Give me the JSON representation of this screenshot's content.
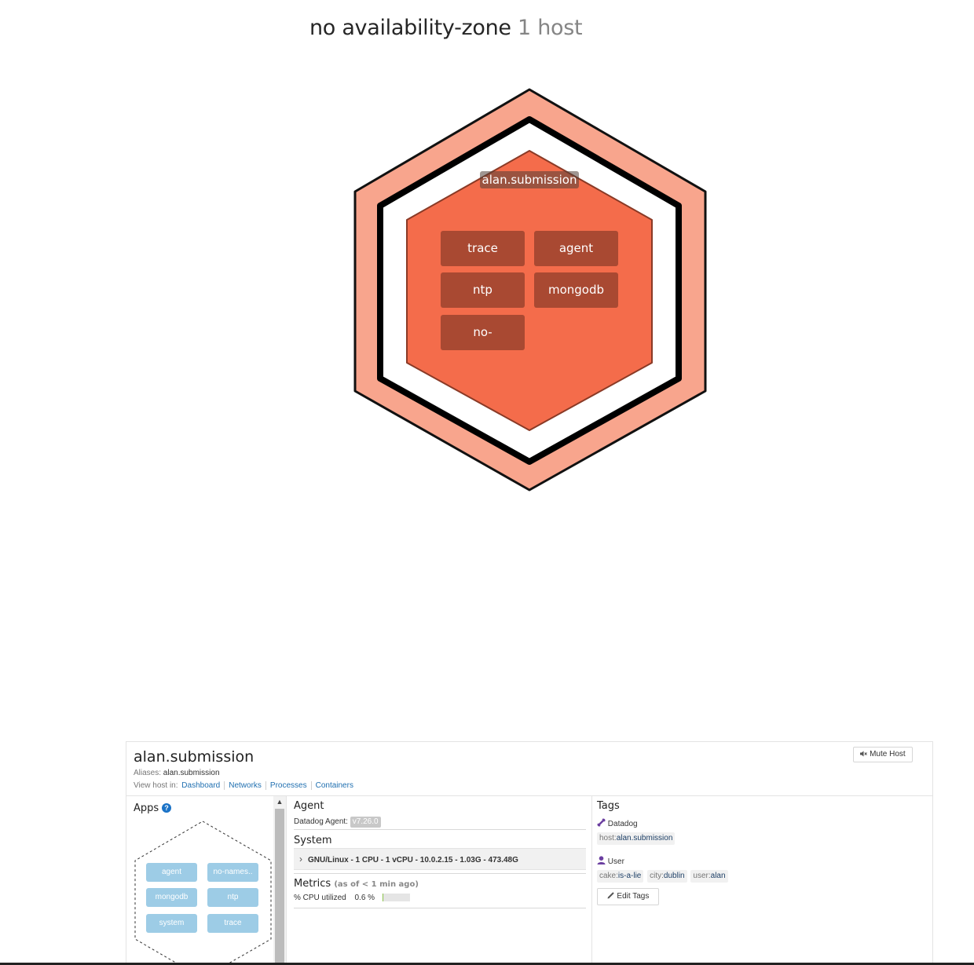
{
  "zone": {
    "name": "no availability-zone",
    "count": "1 host"
  },
  "host_map": {
    "host_label": "alan.submission",
    "apps": [
      "trace",
      "agent",
      "ntp",
      "mongodb",
      "no-"
    ],
    "colors": {
      "outer_ring": "#f8a58d",
      "inner_hex": "#f46c4b",
      "tile": "#a94932"
    }
  },
  "panel": {
    "title": "alan.submission",
    "aliases_label": "Aliases:",
    "aliases_value": "alan.submission",
    "view_in_label": "View host in:",
    "links": [
      "Dashboard",
      "Networks",
      "Processes",
      "Containers"
    ],
    "mute_label": "Mute Host",
    "apps": {
      "title": "Apps",
      "help": "?",
      "items": [
        "agent",
        "no-names..",
        "mongodb",
        "ntp",
        "system",
        "trace"
      ]
    },
    "agent": {
      "title": "Agent",
      "label": "Datadog Agent:",
      "version": "v7.26.0"
    },
    "system": {
      "title": "System",
      "summary": "GNU/Linux - 1 CPU - 1 vCPU - 10.0.2.15 - 1.03G - 473.48G"
    },
    "metrics": {
      "title": "Metrics",
      "subtitle": "(as of < 1 min ago)",
      "cpu_label": "% CPU utilized",
      "cpu_value": "0.6 %",
      "cpu_fraction": 0.006
    },
    "tags": {
      "title": "Tags",
      "datadog_label": "Datadog",
      "datadog_tags": [
        {
          "k": "host:",
          "v": "alan.submission"
        }
      ],
      "user_label": "User",
      "user_tags": [
        {
          "k": "cake:",
          "v": "is-a-lie"
        },
        {
          "k": "city:",
          "v": "dublin"
        },
        {
          "k": "user:",
          "v": "alan"
        }
      ],
      "edit_label": "Edit Tags"
    }
  }
}
